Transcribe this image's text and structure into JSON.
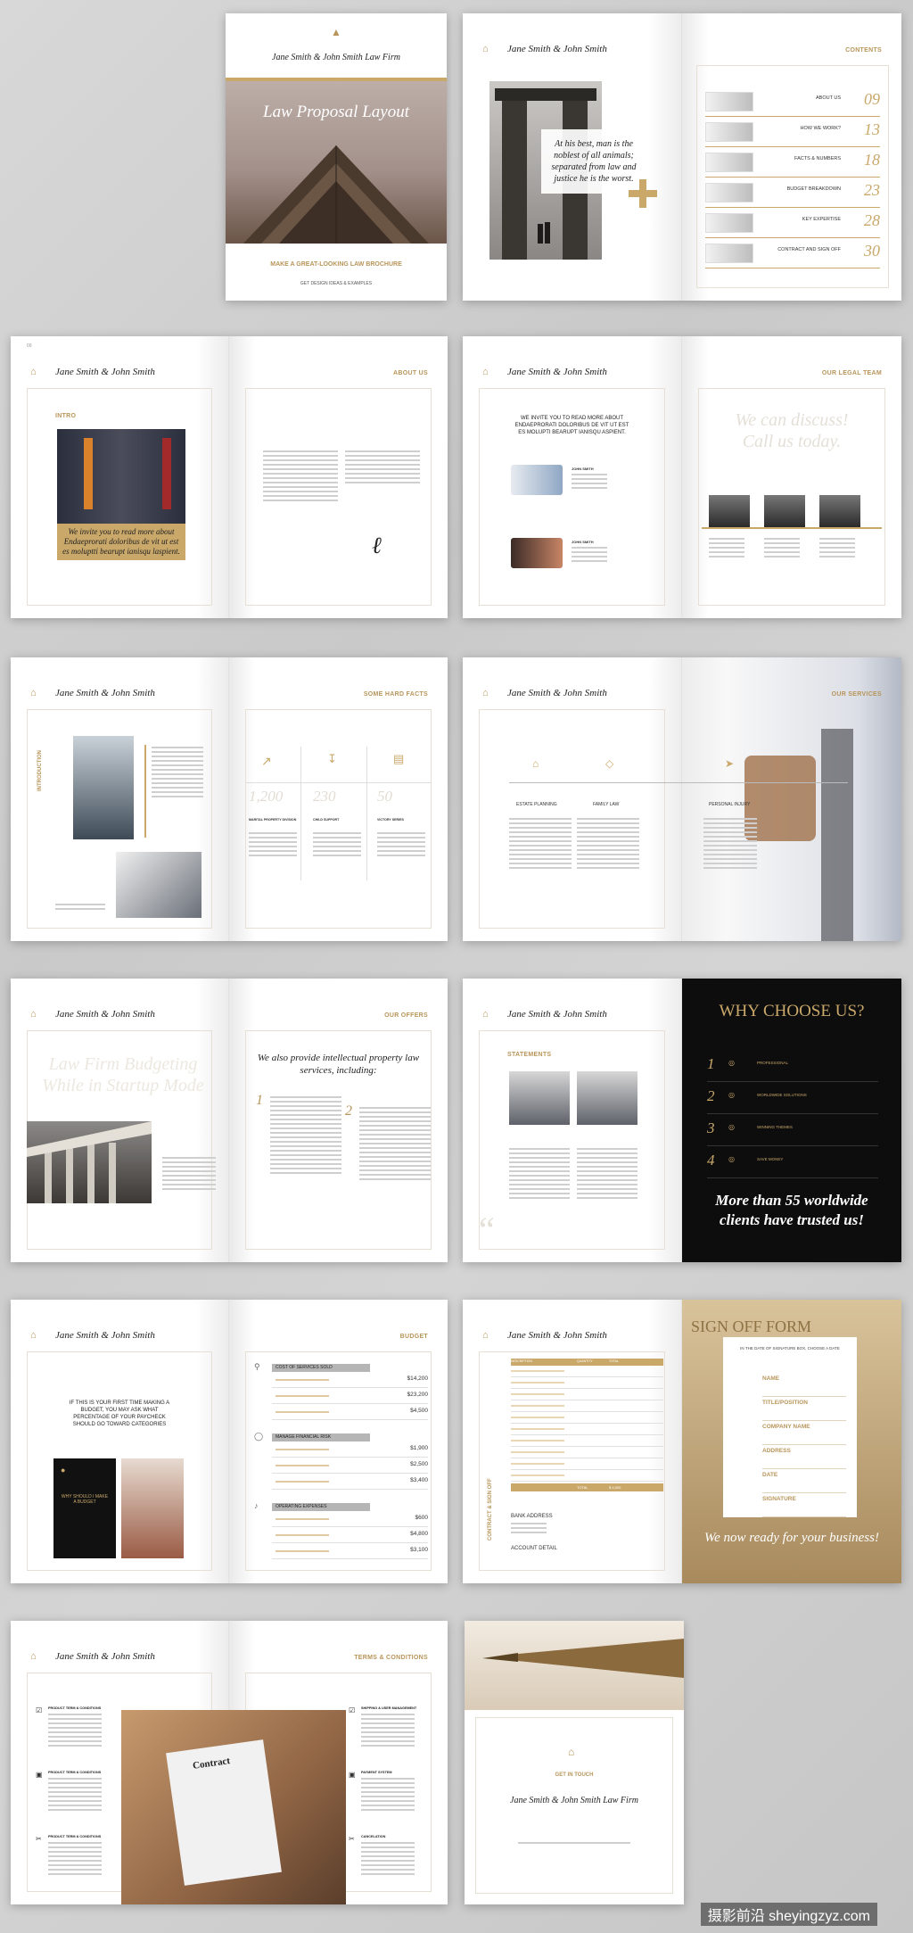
{
  "cover": {
    "firm": "Jane Smith & John Smith Law Firm",
    "title": "Law Proposal Layout",
    "tagline": "MAKE A GREAT-LOOKING LAW BROCHURE",
    "sub": "GET DESIGN IDEAS & EXAMPLES"
  },
  "brand": "Jane Smith & John Smith",
  "contents": {
    "title": "CONTENTS",
    "quote": "At his best, man is the noblest of all animals; separated from law and justice he is the worst.",
    "items": [
      {
        "label": "ABOUT US",
        "num": "09"
      },
      {
        "label": "HOW WE WORK?",
        "num": "13"
      },
      {
        "label": "FACTS & NUMBERS",
        "num": "18"
      },
      {
        "label": "BUDGET BREAKDOWN",
        "num": "23"
      },
      {
        "label": "KEY EXPERTISE",
        "num": "28"
      },
      {
        "label": "CONTRACT AND SIGN OFF",
        "num": "30"
      }
    ]
  },
  "about": {
    "title": "ABOUT US",
    "intro": "INTRO",
    "invite": "We invite you to read more about Endaeprorati doloribus de vit ut est es moluptti bearupt ianisqu laspient."
  },
  "team": {
    "title": "OUR LEGAL TEAM",
    "invite": "WE INVITE YOU TO READ MORE ABOUT ENDAEPRORATI DOLORIBUS DE VIT UT EST ES MOLUPTI BEARUPT IANISQU ASPIENT.",
    "discuss": "We can discuss! Call us today.",
    "member": "JOHN SMITH"
  },
  "facts": {
    "title": "SOME HARD FACTS",
    "intro": "INTRODUCTION",
    "stats": [
      "1,200",
      "230",
      "50"
    ],
    "labels": [
      "MARITAL PROPERTY DIVISION",
      "CHILD SUPPORT",
      "VICTORY SERIES"
    ]
  },
  "services": {
    "title": "OUR SERVICES",
    "items": [
      "ESTATE PLANNING",
      "FAMILY LAW",
      "PERSONAL INJURY"
    ]
  },
  "offers": {
    "title": "OUR OFFERS",
    "ghost": "Law Firm Budgeting While in Startup Mode",
    "heading": "We also provide intellectual property law services, including:",
    "n1": "1",
    "n2": "2"
  },
  "choose": {
    "statements": "STATEMENTS",
    "title": "WHY CHOOSE US?",
    "nums": [
      "1",
      "2",
      "3",
      "4"
    ],
    "items": [
      "PROFESSIONAL",
      "WORLDWIDE SOLUTIONS",
      "WINNING THEMES",
      "SAVE MONEY"
    ],
    "claim": "More than 55 worldwide clients have trusted us!"
  },
  "budget": {
    "title": "BUDGET",
    "lead": "IF THIS IS YOUR FIRST TIME MAKING A BUDGET, YOU MAY ASK WHAT PERCENTAGE OF YOUR PAYCHECK SHOULD GO TOWARD CATEGORIES",
    "dark": "WHY SHOULD I MAKE A BUDGET",
    "groups": [
      {
        "name": "COST OF SERVICES SOLD",
        "values": [
          "$14,200",
          "$23,200",
          "$4,500"
        ]
      },
      {
        "name": "MANAGE FINANCIAL RISK",
        "values": [
          "$1,900",
          "$2,500",
          "$3,400"
        ]
      },
      {
        "name": "OPERATING EXPENSES",
        "values": [
          "$600",
          "$4,800",
          "$3,100"
        ]
      }
    ]
  },
  "signoff": {
    "side": "CONTRACT & SIGN OFF",
    "title": "SIGN OFF FORM",
    "note": "IN THE DATE OF SIGNATURE BOX, CHOOSE A DATE",
    "fields": [
      "NAME",
      "TITLE/POSITION",
      "COMPANY NAME",
      "ADDRESS",
      "DATE",
      "SIGNATURE"
    ],
    "ready": "We now ready for your business!",
    "bank": "BANK ADDRESS",
    "account": "ACCOUNT DETAIL",
    "total": "TOTAL",
    "total_val": "$ 4,500",
    "cols": [
      "DESCRIPTION",
      "QUANTITY",
      "TOTAL"
    ]
  },
  "terms": {
    "title": "TERMS & CONDITIONS",
    "contract": "Contract",
    "left": [
      "PRODUCT TERM & CONDITIONS",
      "PRODUCT TERM & CONDITIONS",
      "PRODUCT TERM & CONDITIONS"
    ],
    "right": [
      "SHIPPING & USER MANAGEMENT",
      "PAYMENT SYSTEM",
      "CANCELATION"
    ]
  },
  "back": {
    "touch": "GET IN TOUCH",
    "firm": "Jane Smith & John Smith Law Firm"
  },
  "watermark": "摄影前沿 sheyingzyz.com"
}
